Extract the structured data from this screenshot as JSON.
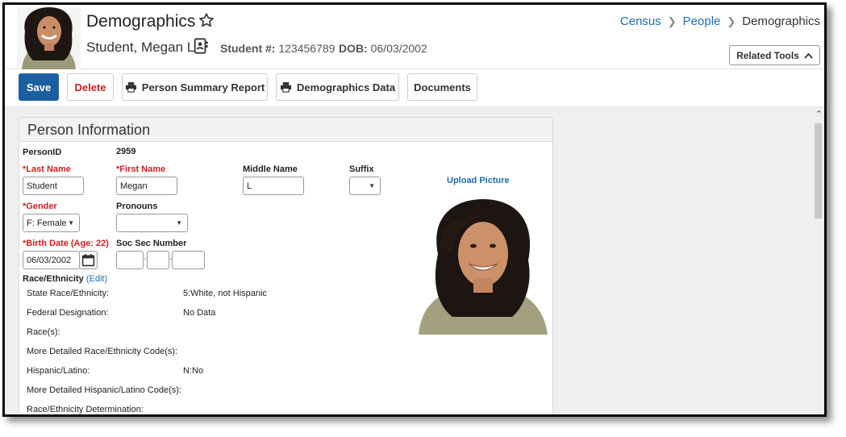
{
  "header": {
    "title": "Demographics",
    "student_name": "Student, Megan L",
    "student_num_label": "Student #:",
    "student_num": "123456789",
    "dob_label": "DOB:",
    "dob": "06/03/2002",
    "breadcrumb": [
      "Census",
      "People",
      "Demographics"
    ],
    "related_tools": "Related Tools"
  },
  "toolbar": {
    "save": "Save",
    "delete": "Delete",
    "person_summary": "Person Summary Report",
    "demographics_data": "Demographics Data",
    "documents": "Documents"
  },
  "panel": {
    "title": "Person Information",
    "person_id_label": "PersonID",
    "person_id": "2959",
    "last_name_label": "*Last Name",
    "last_name": "Student",
    "first_name_label": "*First Name",
    "first_name": "Megan",
    "middle_name_label": "Middle Name",
    "middle_name": "L",
    "suffix_label": "Suffix",
    "suffix": "",
    "gender_label": "*Gender",
    "gender": "F: Female",
    "pronouns_label": "Pronouns",
    "pronouns": "",
    "birth_date_label": "*Birth Date (Age: 22)",
    "birth_date": "06/03/2002",
    "ssn_label": "Soc Sec Number",
    "race_label": "Race/Ethnicity",
    "race_edit": "(Edit)",
    "upload_picture": "Upload Picture",
    "race_rows": [
      {
        "label": "State Race/Ethnicity:",
        "value": "5:White, not Hispanic"
      },
      {
        "label": "Federal Designation:",
        "value": "No Data"
      },
      {
        "label": "Race(s):",
        "value": ""
      },
      {
        "label": "More Detailed Race/Ethnicity Code(s):",
        "value": ""
      },
      {
        "label": "Hispanic/Latino:",
        "value": "N:No"
      },
      {
        "label": "More Detailed Hispanic/Latino Code(s):",
        "value": ""
      },
      {
        "label": "Race/Ethnicity Determination:",
        "value": ""
      }
    ]
  },
  "colors": {
    "primary": "#1c5fa0",
    "required": "#d21f1f",
    "link": "#1f6bb0"
  },
  "icons": [
    "star-icon",
    "contact-card-icon",
    "chevron-right-icon",
    "chevron-up-icon",
    "printer-icon",
    "calendar-icon",
    "caret-down-icon"
  ]
}
